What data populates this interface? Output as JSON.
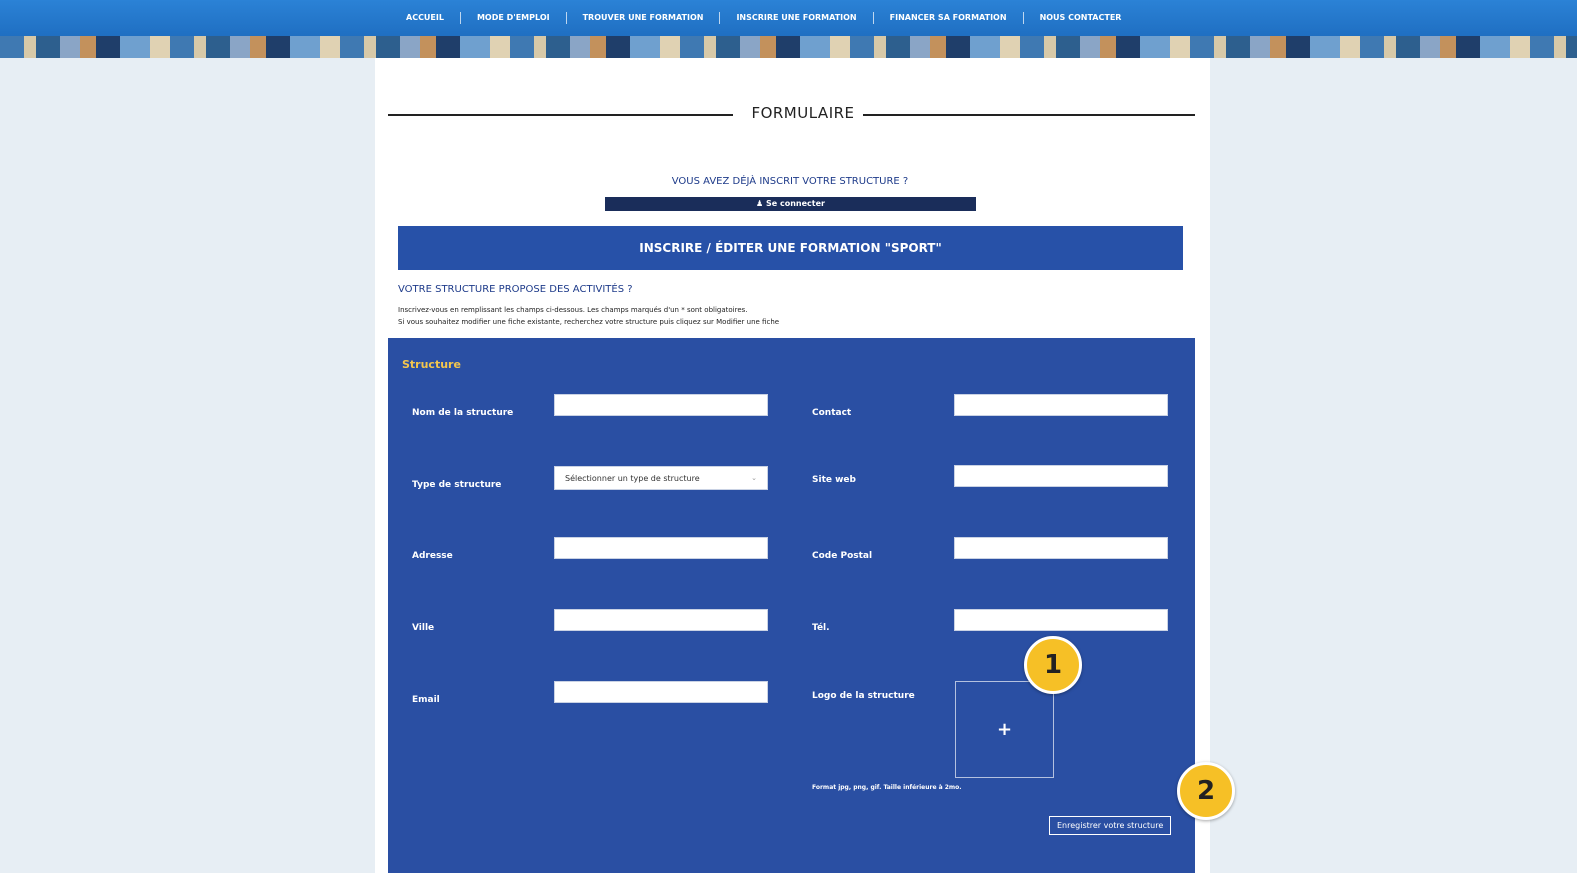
{
  "nav": {
    "items": [
      "ACCUEIL",
      "MODE D'EMPLOI",
      "TROUVER UNE FORMATION",
      "INSCRIRE UNE FORMATION",
      "FINANCER SA FORMATION",
      "NOUS CONTACTER"
    ]
  },
  "page": {
    "heading": "FORMULAIRE",
    "already_question": "VOUS AVEZ DÉJÀ INSCRIT VOTRE STRUCTURE ?",
    "connect_label": "Se connecter",
    "connect_icon": "user-icon",
    "section_banner": "INSCRIRE / ÉDITER UNE FORMATION \"SPORT\"",
    "activites_title": "VOTRE STRUCTURE PROPOSE DES ACTIVITÉS ?",
    "instructions_line1": "Inscrivez-vous en remplissant les champs ci-dessous. Les champs marqués d'un * sont obligatoires.",
    "instructions_line2": "Si vous souhaitez modifier une fiche existante, recherchez votre structure puis cliquez sur Modifier une fiche"
  },
  "form": {
    "section_title": "Structure",
    "labels": {
      "nom": "Nom de la structure",
      "contact": "Contact",
      "type": "Type de structure",
      "site": "Site web",
      "adresse": "Adresse",
      "code_postal": "Code Postal",
      "ville": "Ville",
      "tel": "Tél.",
      "email": "Email",
      "logo": "Logo de la structure"
    },
    "values": {
      "nom": "",
      "contact": "",
      "site": "",
      "adresse": "",
      "code_postal": "",
      "ville": "",
      "tel": "",
      "email": ""
    },
    "type_placeholder": "Sélectionner un type de structure",
    "logo_add_symbol": "+",
    "format_note": "Format jpg, png, gif. Taille inférieure à 2mo.",
    "save_label": "Enregistrer votre structure"
  },
  "badges": [
    "1",
    "2"
  ],
  "colors": {
    "nav": "#1f6fc2",
    "panel": "#2a4fa3",
    "banner": "#2751a8",
    "accent": "#f3c64d",
    "badge": "#f6c026"
  }
}
